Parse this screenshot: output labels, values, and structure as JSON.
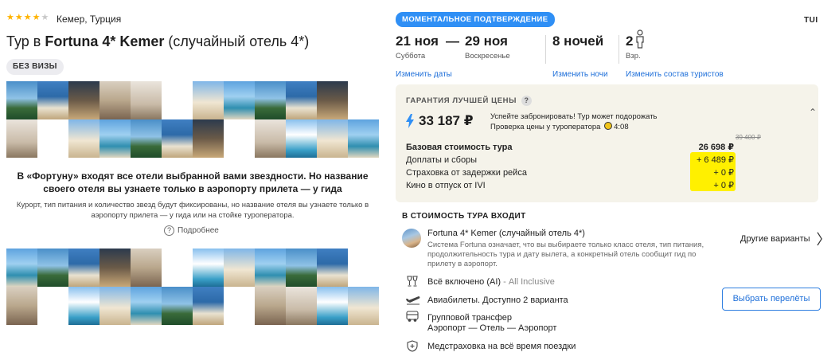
{
  "header": {
    "stars_filled": 4,
    "stars_total": 5,
    "location": "Кемер, Турция",
    "title_prefix": "Тур в ",
    "title_bold": "Fortuna 4* Kemer",
    "title_suffix": " (случайный отель 4*)",
    "visa_badge": "БЕЗ ВИЗЫ"
  },
  "description": {
    "bold": "В «Фортуну» входят все отели выбранной вами звездности. Но название своего отеля вы узнаете только в аэропорту прилета — у гида",
    "small": "Курорт, тип питания и количество звезд будут фиксированы, но название отеля вы узнаете только в аэропорту прилета — у гида или на стойке туроператора.",
    "more_label": "Подробнее"
  },
  "booking": {
    "instant_badge": "МОМЕНТАЛЬНОЕ ПОДТВЕРЖДЕНИЕ",
    "operator": "TUI",
    "date_from": "21 ноя",
    "date_from_day": "Суббота",
    "date_dash": "—",
    "date_to": "29 ноя",
    "date_to_day": "Воскресенье",
    "nights": "8 ночей",
    "adults": "2",
    "adults_label": "Взр.",
    "link_dates": "Изменить даты",
    "link_nights": "Изменить ночи",
    "link_tourists": "Изменить состав туристов"
  },
  "price": {
    "guarantee": "ГАРАНТИЯ ЛУЧШЕЙ ЦЕНЫ",
    "total": "33 187 ₽",
    "note_line1": "Успейте забронировать! Тур может подорожать",
    "note_line2": "Проверка цены у туроператора",
    "timer": "4:08",
    "old_price": "39 400 ₽",
    "rows": [
      {
        "label": "Базовая стоимость тура",
        "value": "26 698 ₽"
      },
      {
        "label": "Доплаты и сборы",
        "value": "+ 6 489 ₽"
      },
      {
        "label": "Страховка от задержки рейса",
        "value": "+ 0 ₽"
      },
      {
        "label": "Кино в отпуск от IVI",
        "value": "+ 0 ₽"
      }
    ],
    "highlight_color": "#fff000"
  },
  "included": {
    "title": "В СТОИМОСТЬ ТУРА ВХОДИТ",
    "hotel_name": "Fortuna 4* Kemer (случайный отель 4*)",
    "hotel_desc": "Система Fortuna означает, что вы выбираете только класс отеля, тип питания, продолжительность тура и дату вылета, а конкретный отель сообщит гид по прилету в аэропорт.",
    "other_variants": "Другие варианты",
    "meal_main": "Всё включено (AI)",
    "meal_sub": " - All Inclusive",
    "flights": "Авиабилеты. Доступно 2 варианта",
    "flights_button": "Выбрать перелёты",
    "transfer_line1": "Групповой трансфер",
    "transfer_line2": "Аэропорт — Отель — Аэропорт",
    "insurance": "Медстраховка на всё время поездки"
  },
  "colors": {
    "accent": "#2f8ff5",
    "link": "#1e6fd9",
    "price_box": "#f5f3ea",
    "star": "#ffb300"
  }
}
